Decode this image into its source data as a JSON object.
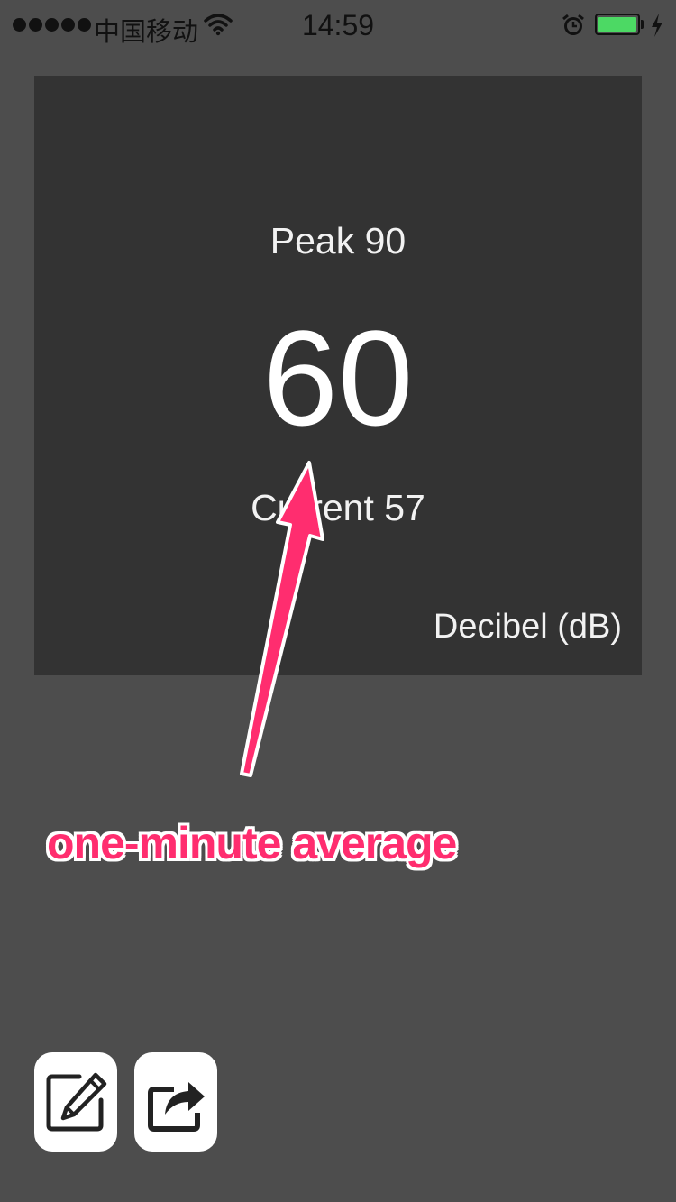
{
  "status_bar": {
    "carrier": "中国移动",
    "time": "14:59",
    "battery_color": "#4cd964"
  },
  "meter": {
    "peak_text": "Peak 90",
    "average_value": "60",
    "current_text": "Current 57",
    "unit_label": "Decibel (dB)"
  },
  "annotation": {
    "text": "one-minute average",
    "color": "#ff2d6f"
  },
  "actions": {
    "edit_icon": "pencil-square-icon",
    "share_icon": "share-arrow-icon"
  }
}
